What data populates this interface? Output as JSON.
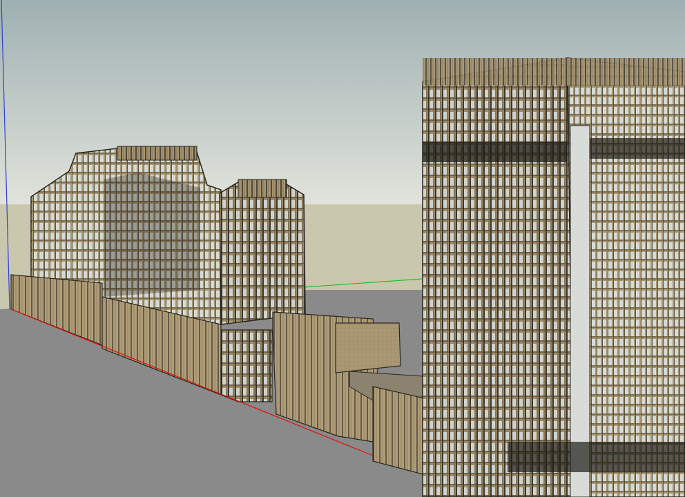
{
  "viewport": {
    "colors": {
      "sky_top": "#9fb0b2",
      "sky_bottom": "#e0e3dc",
      "ground_far": "#c9c7ae",
      "ground_near": "#8a8a8a",
      "building_tan": "#a49270",
      "building_dark": "#2a2720",
      "glass": "#d8dcd8",
      "axis_red": "#e01010",
      "axis_green": "#22c022",
      "axis_blue": "#3040d0"
    }
  }
}
